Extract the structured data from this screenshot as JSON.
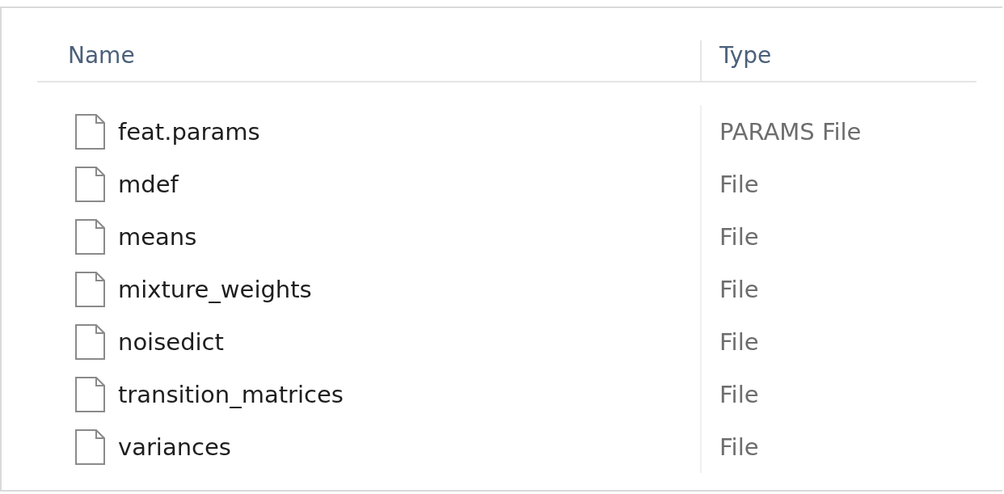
{
  "columns": [
    {
      "label": "Name"
    },
    {
      "label": "Type"
    }
  ],
  "rows": [
    {
      "name": "feat.params",
      "type": "PARAMS File"
    },
    {
      "name": "mdef",
      "type": "File"
    },
    {
      "name": "means",
      "type": "File"
    },
    {
      "name": "mixture_weights",
      "type": "File"
    },
    {
      "name": "noisedict",
      "type": "File"
    },
    {
      "name": "transition_matrices",
      "type": "File"
    },
    {
      "name": "variances",
      "type": "File"
    }
  ]
}
